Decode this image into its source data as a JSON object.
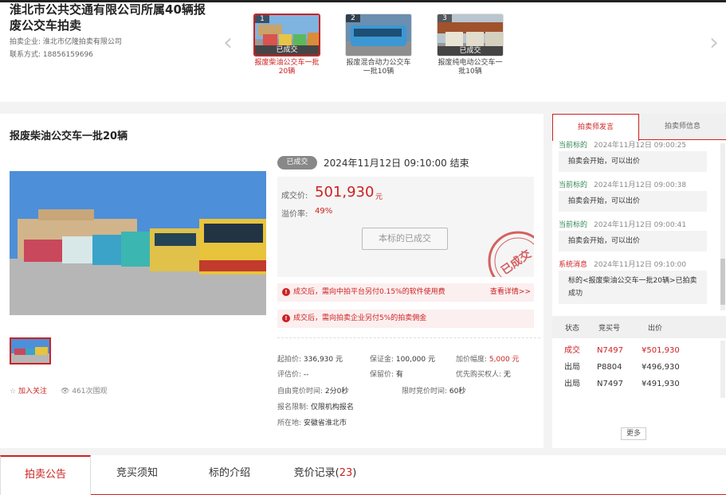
{
  "header": {
    "title": "淮北市公共交通有限公司所属40辆报废公交车拍卖",
    "company_label": "拍卖企业:",
    "company": "淮北市亿隆拍卖有限公司",
    "contact_label": "联系方式:",
    "contact": "18856159696"
  },
  "lots": [
    {
      "num": "1",
      "state": "已成交",
      "caption": "报废柴油公交车一批20辆"
    },
    {
      "num": "2",
      "state": "",
      "caption": "报废混合动力公交车一批10辆"
    },
    {
      "num": "3",
      "state": "已成交",
      "caption": "报废纯电动公交车一批10辆"
    }
  ],
  "lot": {
    "title": "报废柴油公交车一批20辆",
    "status_badge": "已成交",
    "end_time": "2024年11月12日  09:10:00 结束",
    "deal_label": "成交价:",
    "deal_price": "501,930",
    "deal_unit": "元",
    "premium_label": "溢价率:",
    "premium": "49%",
    "done_button": "本标的已成交",
    "stamp_text": "已成交",
    "notice1": "成交后，需向中拍平台另付0.15%的软件使用费",
    "notice1_link": "查看详情>>",
    "notice2": "成交后，需向拍卖企业另付5%的拍卖佣金",
    "follow": "加入关注",
    "views": "461次围观"
  },
  "details": {
    "start_label": "起拍价:",
    "start": "336,930 元",
    "deposit_label": "保证金:",
    "deposit": "100,000 元",
    "increment_label": "加价幅度:",
    "increment": "5,000 元",
    "appraise_label": "评估价:",
    "appraise": "--",
    "reserve_label": "保留价:",
    "reserve": "有",
    "priority_label": "优先购买权人:",
    "priority": "无",
    "free_time_label": "自由竞价时间:",
    "free_time": "2分0秒",
    "limit_time_label": "限时竞价时间:",
    "limit_time": "60秒",
    "signup_label": "报名限制:",
    "signup": "仅限机构报名",
    "location_label": "所在地:",
    "location": "安徽省淮北市"
  },
  "side": {
    "tab_active": "拍卖师发言",
    "tab_other": "拍卖师信息",
    "messages": [
      {
        "who": "当前标的",
        "time": "2024年11月12日  09:00:25",
        "text": "拍卖会开始，可以出价",
        "sys": false
      },
      {
        "who": "当前标的",
        "time": "2024年11月12日  09:00:38",
        "text": "拍卖会开始，可以出价",
        "sys": false
      },
      {
        "who": "当前标的",
        "time": "2024年11月12日  09:00:41",
        "text": "拍卖会开始，可以出价",
        "sys": false
      },
      {
        "who": "系统消息",
        "time": "2024年11月12日  09:10:00",
        "text": "标的<报废柴油公交车一批20辆>已拍卖成功",
        "sys": true
      }
    ],
    "bid_headers": [
      "状态",
      "竞买号",
      "出价"
    ],
    "bids": [
      {
        "status": "成交",
        "number": "N7497",
        "price": "¥501,930",
        "win": true
      },
      {
        "status": "出局",
        "number": "P8804",
        "price": "¥496,930",
        "win": false
      },
      {
        "status": "出局",
        "number": "N7497",
        "price": "¥491,930",
        "win": false
      }
    ],
    "more": "更多"
  },
  "tabs": [
    {
      "label": "拍卖公告",
      "count": ""
    },
    {
      "label": "竞买须知",
      "count": ""
    },
    {
      "label": "标的介绍",
      "count": ""
    },
    {
      "label": "竞价记录(",
      "count": "23",
      "close": ")"
    }
  ],
  "colors": {
    "accent": "#cc2222"
  }
}
